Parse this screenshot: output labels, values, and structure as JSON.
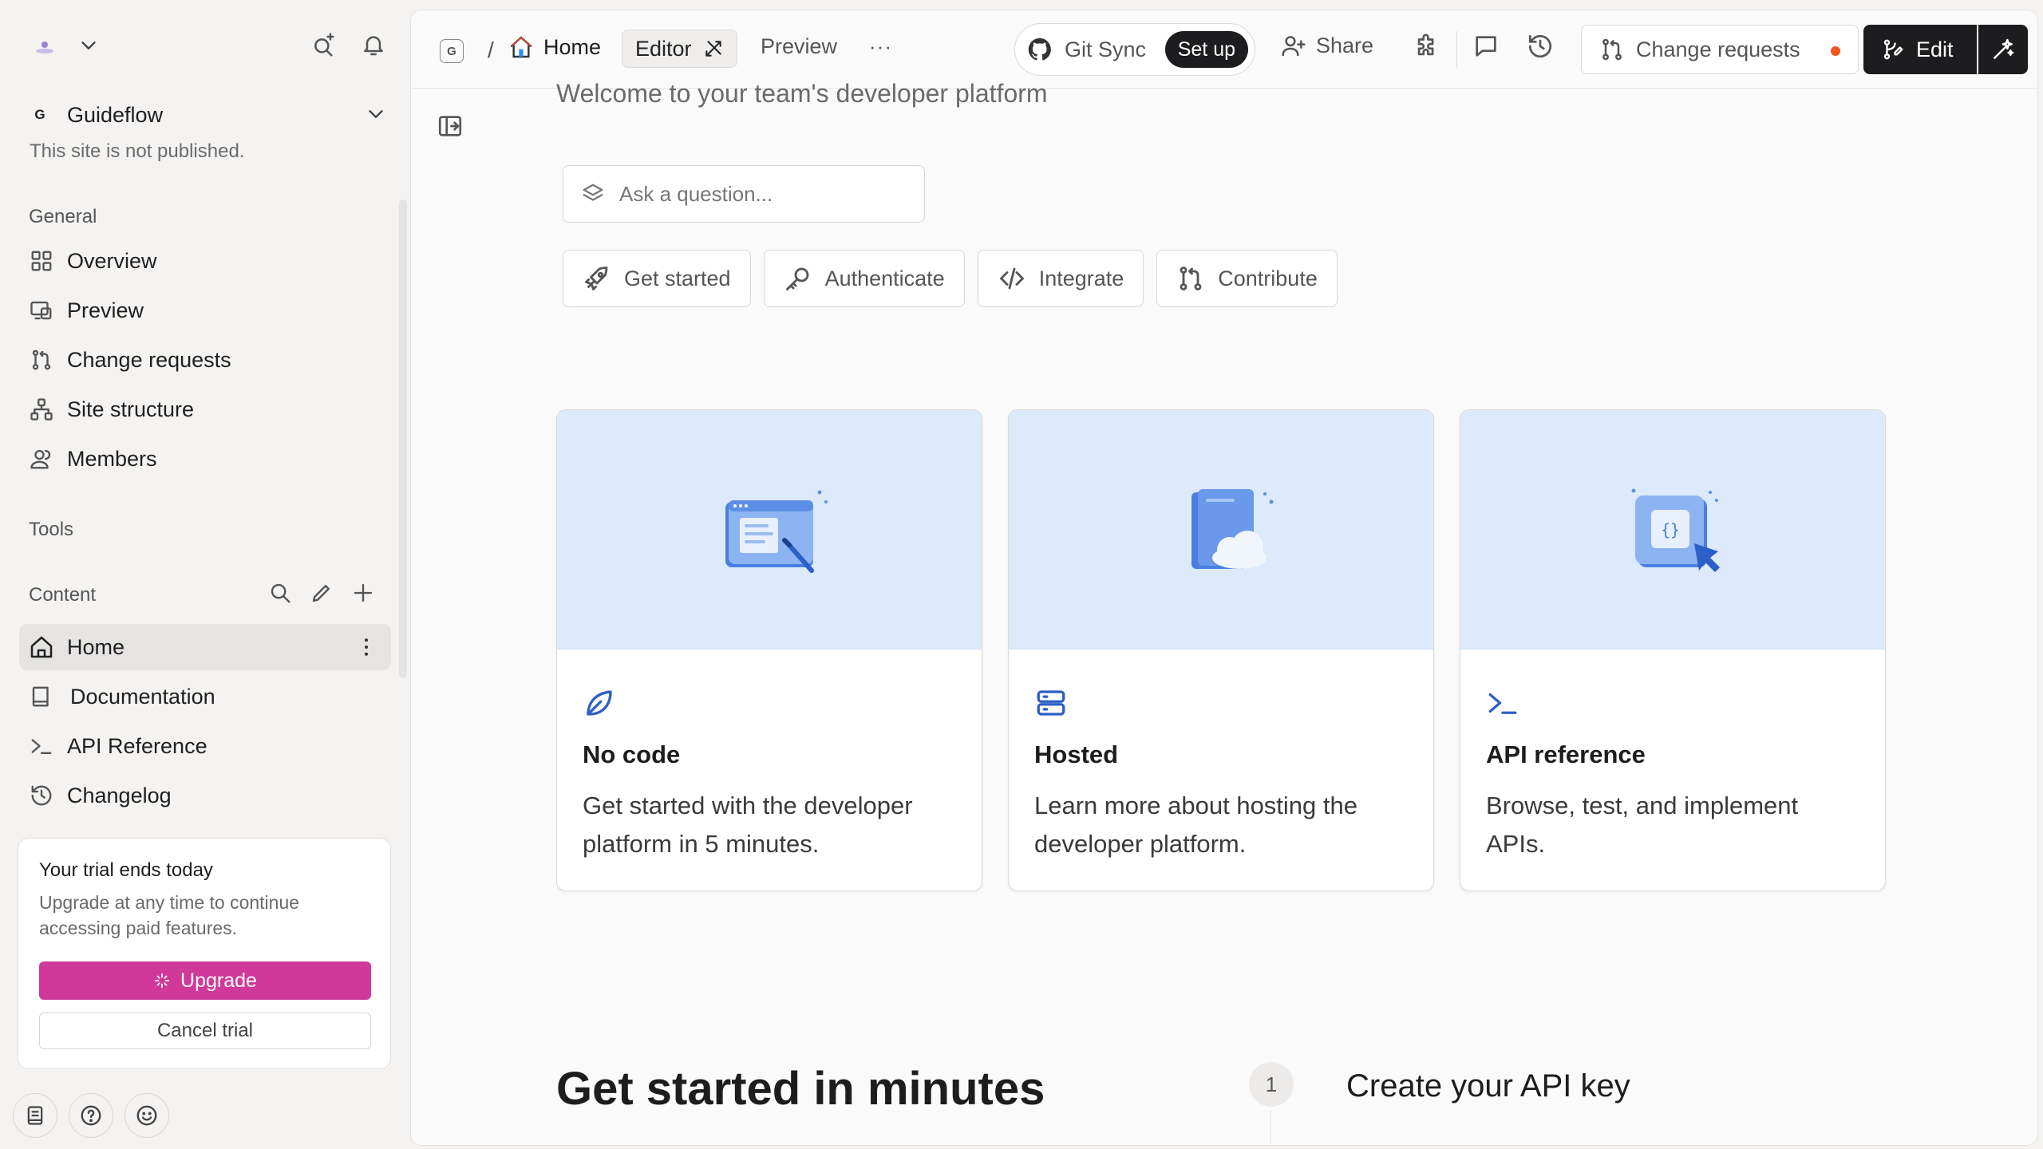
{
  "sidebar": {
    "site": {
      "badge": "G",
      "name": "Guideflow",
      "status": "This site is not published."
    },
    "sections": {
      "general": "General",
      "tools": "Tools",
      "content": "Content"
    },
    "general_items": [
      {
        "label": "Overview",
        "icon": "grid-icon"
      },
      {
        "label": "Preview",
        "icon": "preview-icon"
      },
      {
        "label": "Change requests",
        "icon": "change-request-icon"
      },
      {
        "label": "Site structure",
        "icon": "site-structure-icon"
      },
      {
        "label": "Members",
        "icon": "members-icon"
      }
    ],
    "content_items": [
      {
        "label": "Home",
        "icon": "home-icon",
        "active": true
      },
      {
        "label": "Documentation",
        "icon": "book-icon"
      },
      {
        "label": "API Reference",
        "icon": "terminal-icon"
      },
      {
        "label": "Changelog",
        "icon": "history-icon"
      }
    ],
    "trial": {
      "title": "Your trial ends today",
      "description": "Upgrade at any time to continue accessing paid features.",
      "upgrade_label": "Upgrade",
      "cancel_label": "Cancel trial"
    }
  },
  "topbar": {
    "breadcrumb_badge": "G",
    "separator": "/",
    "page": "Home",
    "editor_tab": "Editor",
    "preview_tab": "Preview",
    "more": "···",
    "git_sync": "Git Sync",
    "setup": "Set up",
    "share": "Share",
    "change_requests": "Change requests",
    "edit": "Edit"
  },
  "main": {
    "welcome": "Welcome to your team's developer platform",
    "ask_placeholder": "Ask a question...",
    "chips": [
      {
        "label": "Get started",
        "icon": "rocket-icon"
      },
      {
        "label": "Authenticate",
        "icon": "key-icon"
      },
      {
        "label": "Integrate",
        "icon": "code-icon"
      },
      {
        "label": "Contribute",
        "icon": "git-branch-icon"
      }
    ],
    "cards": [
      {
        "title": "No code",
        "description": "Get started with the developer platform in 5 minutes.",
        "icon": "leaf-icon"
      },
      {
        "title": "Hosted",
        "description": "Learn more about hosting the developer platform.",
        "icon": "server-icon"
      },
      {
        "title": "API reference",
        "description": "Browse, test, and implement APIs.",
        "icon": "terminal-icon"
      }
    ],
    "get_started_title": "Get started in minutes",
    "step": {
      "number": "1",
      "title": "Create your API key"
    }
  },
  "colors": {
    "accent_upgrade": "#d0399a",
    "card_hero": "#ddeafb",
    "card_icon": "#2d5fc4",
    "notification_dot": "#f0561f",
    "primary_dark": "#1d1d1f"
  }
}
